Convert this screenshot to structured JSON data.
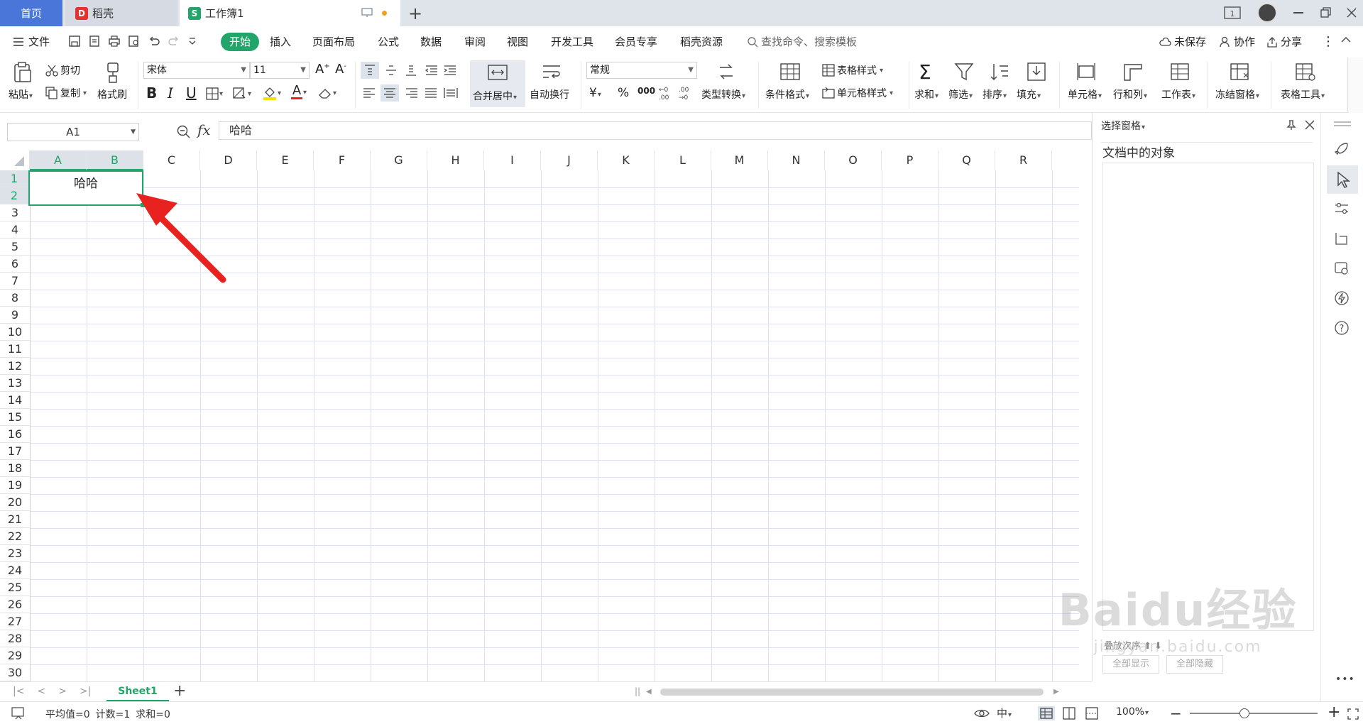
{
  "tabs": {
    "home": "首页",
    "daoke": "稻壳",
    "workbook": "工作簿1"
  },
  "menu": {
    "file": "文件",
    "items": [
      "开始",
      "插入",
      "页面布局",
      "公式",
      "数据",
      "审阅",
      "视图",
      "开发工具",
      "会员专享",
      "稻壳资源"
    ],
    "search": "查找命令、搜索模板",
    "unsaved": "未保存",
    "collab": "协作",
    "share": "分享"
  },
  "ribbon": {
    "paste": "粘贴",
    "cut": "剪切",
    "copy": "复制",
    "format_painter": "格式刷",
    "font_name": "宋体",
    "font_size": "11",
    "merge": "合并居中",
    "wrap": "自动换行",
    "number_format": "常规",
    "currency": "¥",
    "percent": "%",
    "thousands": "000",
    "type_convert": "类型转换",
    "cond_format": "条件格式",
    "table_style": "表格样式",
    "cell_style": "单元格样式",
    "sum": "求和",
    "filter": "筛选",
    "sort": "排序",
    "fill": "填充",
    "cell": "单元格",
    "rowcol": "行和列",
    "sheet": "工作表",
    "freeze": "冻结窗格",
    "table_tools": "表格工具"
  },
  "formula": {
    "cell_ref": "A1",
    "fx": "fx",
    "content": "哈哈"
  },
  "grid": {
    "columns": [
      "A",
      "B",
      "C",
      "D",
      "E",
      "F",
      "G",
      "H",
      "I",
      "J",
      "K",
      "L",
      "M",
      "N",
      "O",
      "P",
      "Q",
      "R"
    ],
    "rows": [
      "1",
      "2",
      "3",
      "4",
      "5",
      "6",
      "7",
      "8",
      "9",
      "10",
      "11",
      "12",
      "13",
      "14",
      "15",
      "16",
      "17",
      "18",
      "19",
      "20",
      "21",
      "22",
      "23",
      "24",
      "25",
      "26",
      "27",
      "28",
      "29",
      "30"
    ],
    "merged_cell_text": "哈哈"
  },
  "panel": {
    "title": "选择窗格",
    "objects_label": "文档中的对象",
    "reorder": "叠放次序",
    "show_all": "全部显示",
    "hide_all": "全部隐藏"
  },
  "sheets": {
    "active": "Sheet1"
  },
  "status": {
    "average": "平均值=0",
    "count": "计数=1",
    "sum": "求和=0",
    "zoom": "100%"
  },
  "watermark": {
    "text": "Baidu经验",
    "url": "jingyan.baidu.com"
  },
  "colors": {
    "accent": "#22a56a",
    "tab_home": "#4a76d9",
    "arrow": "#e8231f",
    "selection": "#22a56a"
  }
}
